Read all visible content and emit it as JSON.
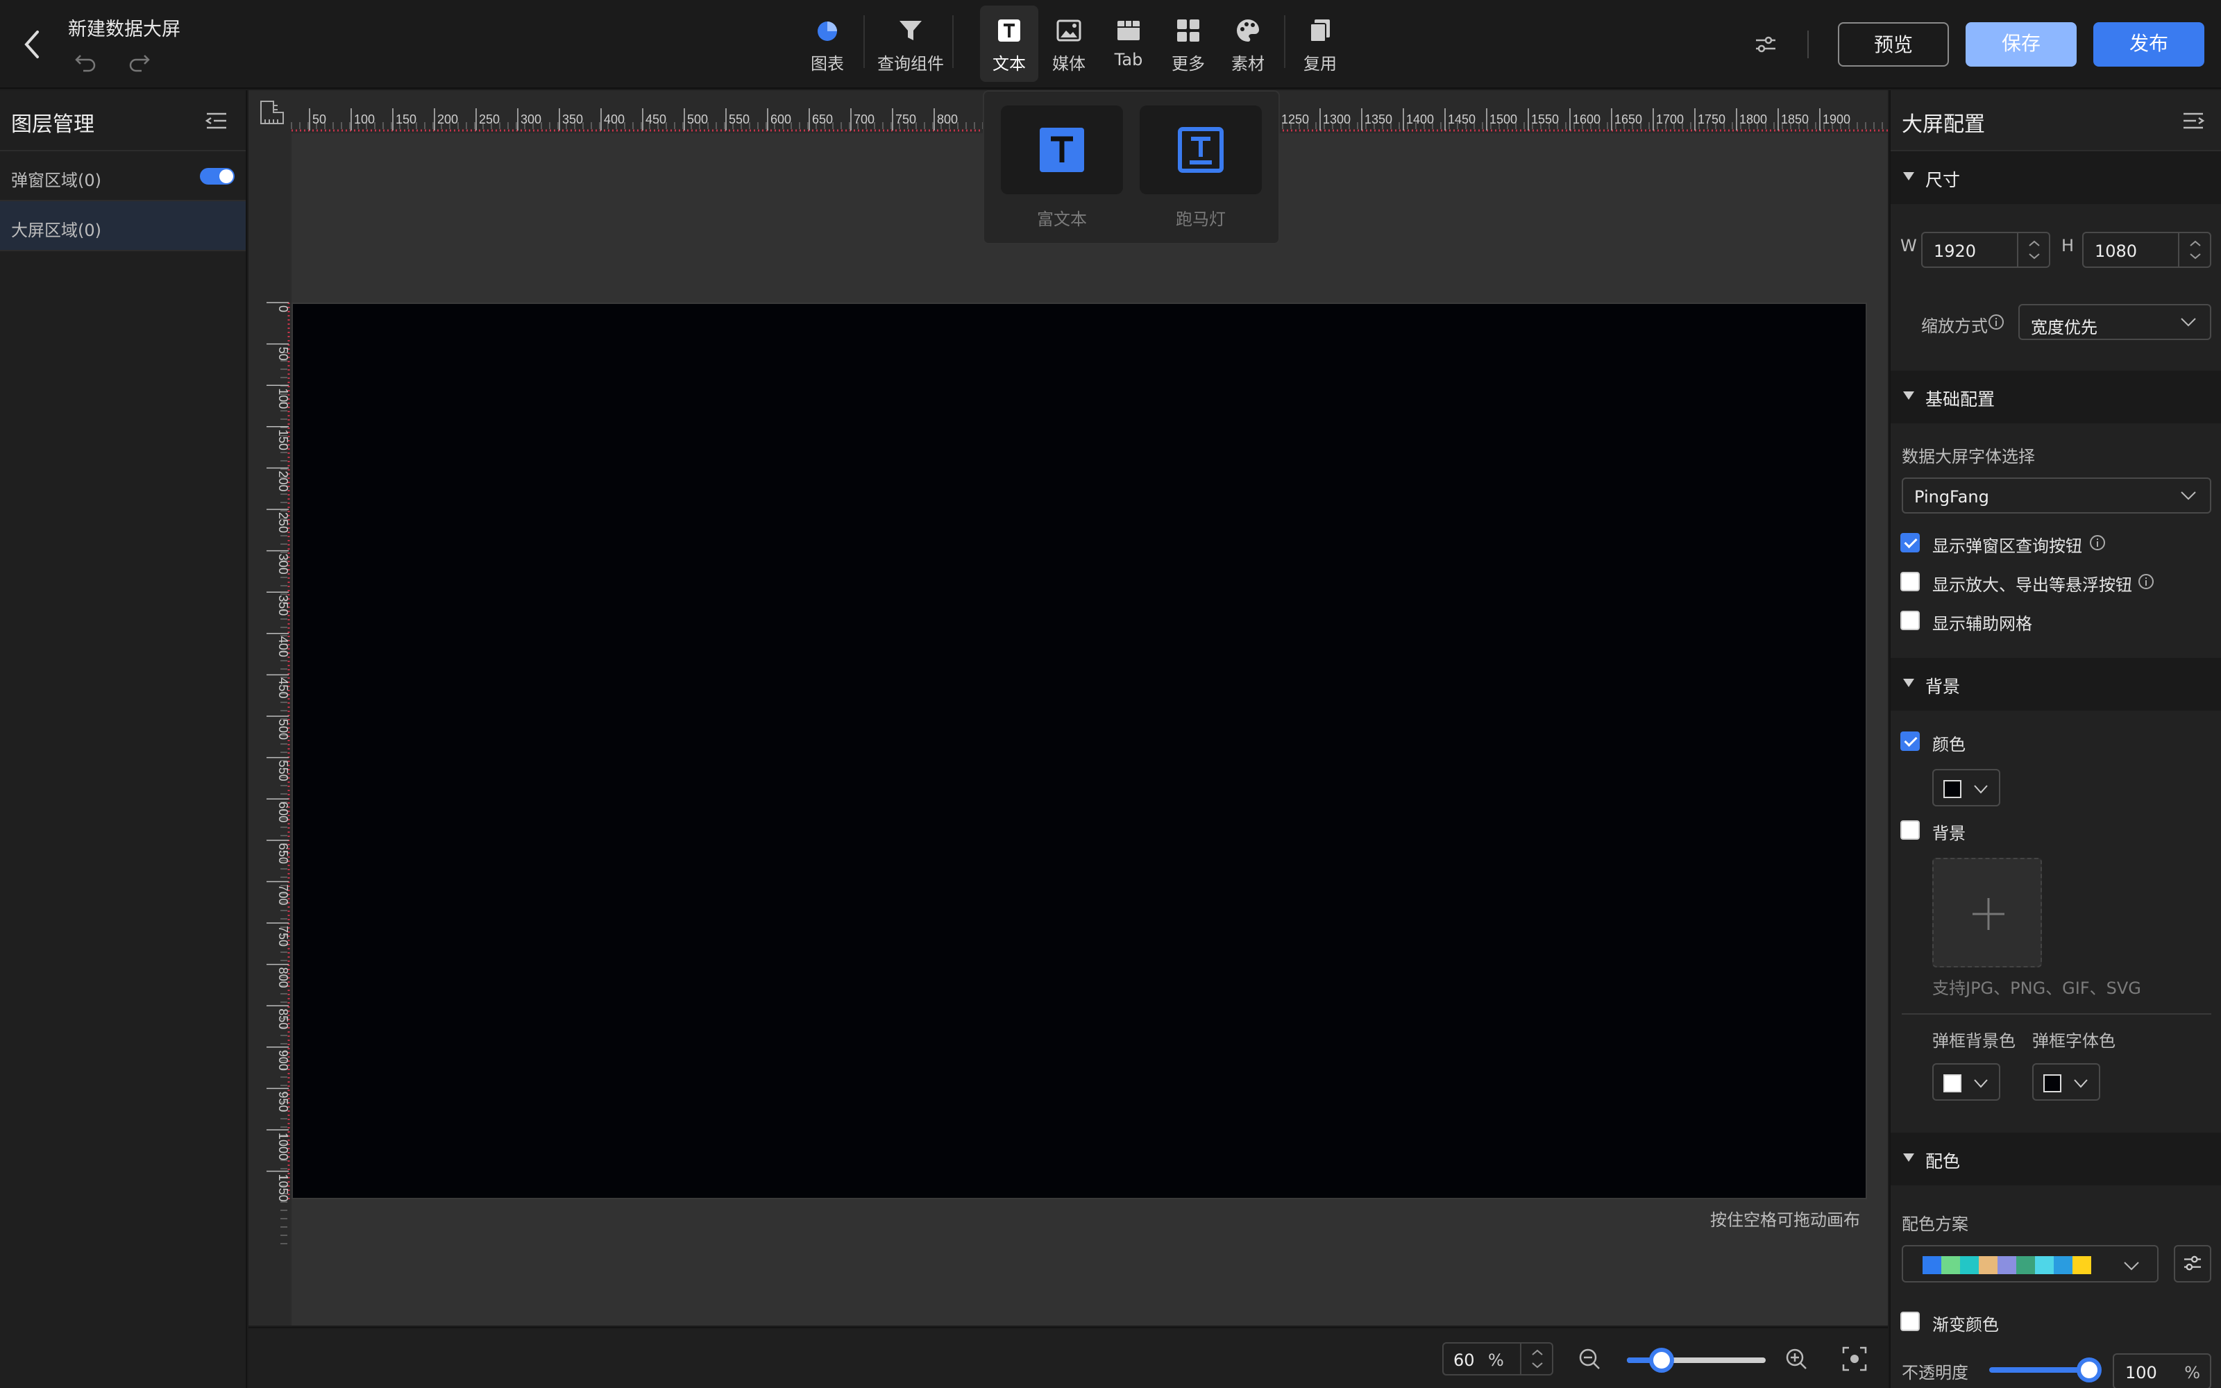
{
  "header": {
    "title": "新建数据大屏",
    "buttons": {
      "preview": "预览",
      "save": "保存",
      "publish": "发布"
    }
  },
  "toolbar": {
    "items": [
      {
        "label": "图表",
        "icon": "pie-chart-icon"
      },
      {
        "label": "查询组件",
        "icon": "filter-icon"
      },
      {
        "label": "文本",
        "icon": "text-icon",
        "active": true
      },
      {
        "label": "媒体",
        "icon": "image-icon"
      },
      {
        "label": "Tab",
        "icon": "tab-icon"
      },
      {
        "label": "更多",
        "icon": "grid-icon"
      },
      {
        "label": "素材",
        "icon": "palette-icon"
      },
      {
        "label": "复用",
        "icon": "copy-icon"
      }
    ]
  },
  "text_popover": {
    "items": [
      {
        "label": "富文本",
        "icon": "rich-text-icon"
      },
      {
        "label": "跑马灯",
        "icon": "marquee-icon"
      }
    ]
  },
  "left_panel": {
    "title": "图层管理",
    "rows": [
      {
        "label": "弹窗区域(0)",
        "toggle": true
      },
      {
        "label": "大屏区域(0)",
        "selected": true
      }
    ]
  },
  "ruler": {
    "top_ticks": [
      "50",
      "100",
      "150",
      "200",
      "250",
      "300",
      "350",
      "400",
      "450",
      "500",
      "550",
      "600",
      "650",
      "700",
      "750",
      "800",
      "1250",
      "1300",
      "1350",
      "1400",
      "1450",
      "1500",
      "1550",
      "1600",
      "1650",
      "1700",
      "1750",
      "1800",
      "1850",
      "1900"
    ],
    "left_ticks": [
      "0",
      "50",
      "100",
      "150",
      "200",
      "250",
      "300",
      "350",
      "400",
      "450",
      "500",
      "550",
      "600",
      "650",
      "700",
      "750",
      "800",
      "850",
      "900",
      "950",
      "1000",
      "1050"
    ]
  },
  "canvas": {
    "hint": "按住空格可拖动画布"
  },
  "bottombar": {
    "zoom_value": "60",
    "zoom_unit": "%",
    "zoom_slider_fraction": 0.25
  },
  "right_panel": {
    "title": "大屏配置",
    "size_section": {
      "title": "尺寸",
      "w_label": "W",
      "w_value": "1920",
      "h_label": "H",
      "h_value": "1080",
      "scale_label": "缩放方式",
      "scale_value": "宽度优先"
    },
    "basic_section": {
      "title": "基础配置",
      "font_label": "数据大屏字体选择",
      "font_value": "PingFang",
      "checks": [
        {
          "label": "显示弹窗区查询按钮",
          "checked": true
        },
        {
          "label": "显示放大、导出等悬浮按钮",
          "checked": false
        },
        {
          "label": "显示辅助网格",
          "checked": false
        }
      ]
    },
    "bg_section": {
      "title": "背景",
      "color_label": "颜色",
      "bg_label": "背景",
      "upload_hint": "支持JPG、PNG、GIF、SVG",
      "dialog_bg_label": "弹框背景色",
      "dialog_font_label": "弹框字体色"
    },
    "color_section": {
      "title": "配色",
      "scheme_label": "配色方案",
      "scheme_colors": [
        "#2e7bf0",
        "#6fd88a",
        "#23c6c6",
        "#e8b97a",
        "#8a8fe0",
        "#3ca37c",
        "#4fd6e8",
        "#2a9ce0",
        "#ffd21a"
      ],
      "gradient_label": "渐变颜色",
      "opacity_label": "不透明度",
      "opacity_value": "100",
      "opacity_unit": "%"
    }
  },
  "colors": {
    "accent": "#3a7bf0",
    "screen_bg": "#020307"
  }
}
